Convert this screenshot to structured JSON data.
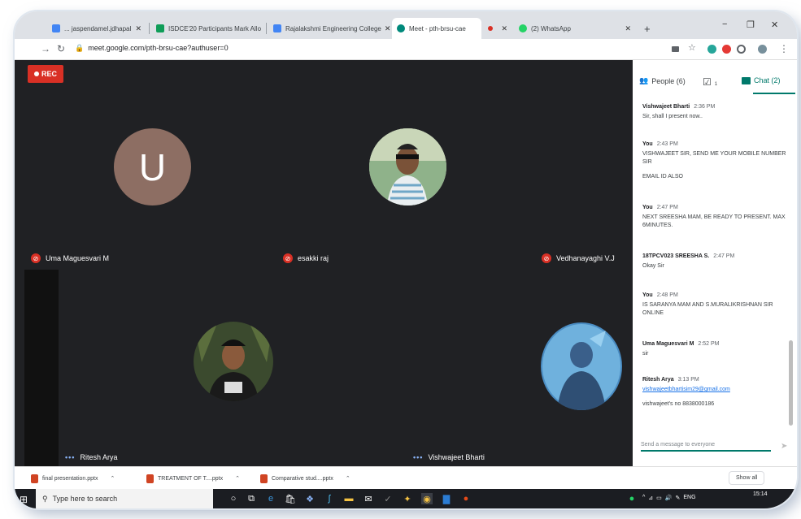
{
  "browser": {
    "tabs": [
      {
        "label": "... jaspendamel.jdhapal",
        "color": "#4285f4"
      },
      {
        "label": "ISDCE'20 Participants Mark Allo",
        "color": "#0f9d58"
      },
      {
        "label": "Rajalakshmi Engineering College",
        "color": "#4285f4"
      },
      {
        "label": "Meet - pth-brsu-cae",
        "color": "#00897b"
      },
      {
        "label": "",
        "color": "#d93025"
      },
      {
        "label": "(2) WhatsApp",
        "color": "#25d366"
      }
    ],
    "new_tab": "+",
    "url": "meet.google.com/pth-brsu-cae?authuser=0"
  },
  "meet": {
    "rec_label": "REC",
    "avatar_letter": "U",
    "participants": [
      "Uma Maguesvari M",
      "esakki raj",
      "Vedhanayaghi V.J",
      "Ritesh Arya",
      "Vishwajeet Bharti"
    ]
  },
  "sidebar": {
    "people_label": "People (6)",
    "tasks_badge": "1",
    "chat_label": "Chat (2)",
    "messages": [
      {
        "sender": "Vishwajeet Bharti",
        "time": "2:36 PM",
        "lines": [
          "Sir, shall I present now.."
        ]
      },
      {
        "sender": "You",
        "time": "2:43 PM",
        "lines": [
          "VISHWAJEET SIR, SEND ME YOUR MOBILE NUMBER SIR",
          "EMAIL ID ALSO"
        ]
      },
      {
        "sender": "You",
        "time": "2:47 PM",
        "lines": [
          "NEXT SREESHA MAM, BE READY TO PRESENT. MAX 6MINUTES."
        ]
      },
      {
        "sender": "18TPCV023 SREESHA S.",
        "time": "2:47 PM",
        "lines": [
          "Okay Sir"
        ]
      },
      {
        "sender": "You",
        "time": "2:48 PM",
        "lines": [
          "IS SARANYA MAM AND S.MURALIKRISHNAN SIR ONLINE"
        ]
      },
      {
        "sender": "Uma Maguesvari M",
        "time": "2:52 PM",
        "lines": [
          "sir"
        ]
      },
      {
        "sender": "Ritesh Arya",
        "time": "3:13 PM",
        "lines": [
          "vishwajeetbhartisim29@gmail.com",
          "vishwajeet's no 8838000186"
        ]
      }
    ],
    "input_placeholder": "Send a message to everyone"
  },
  "downloads": {
    "items": [
      "final presentation.pptx",
      "TREATMENT OF T....pptx",
      "Comparative stud....pptx"
    ],
    "show_all": "Show all"
  },
  "taskbar": {
    "search_placeholder": "Type here to search",
    "tray_lang": "ENG",
    "clock_time": "15:14"
  }
}
